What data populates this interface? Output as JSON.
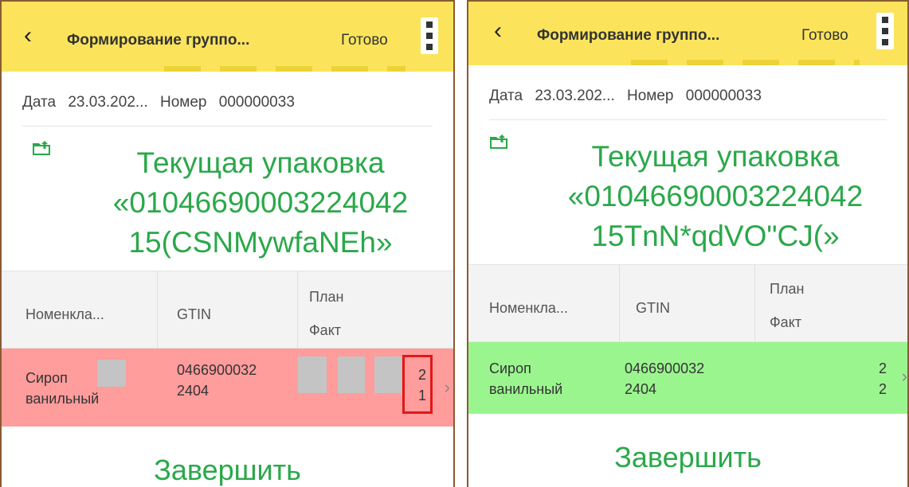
{
  "screens": [
    {
      "header": {
        "back_icon": "chevron-left-icon",
        "title": "Формирование группо...",
        "done_label": "Готово",
        "menu_icon": "more-vertical-icon"
      },
      "info": {
        "date_label": "Дата",
        "date_value": "23.03.202...",
        "number_label": "Номер",
        "number_value": "000000033"
      },
      "current_package": {
        "icon": "package-upload-icon",
        "line1": "Текущая упаковка",
        "line2": "«01046690003224042",
        "line3": "15(CSNMywfaNEh»"
      },
      "table": {
        "col_nomenclature": "Номенкла...",
        "col_gtin": "GTIN",
        "col_plan": "План",
        "col_fact": "Факт",
        "row": {
          "name_line1": "Сироп",
          "name_line2": "ванильный",
          "gtin_line1": "0466900032",
          "gtin_line2": "2404",
          "plan": "2",
          "fact": "1",
          "status_color": "#ff9c9c"
        }
      },
      "finish_label": "Завершить"
    },
    {
      "header": {
        "back_icon": "chevron-left-icon",
        "title": "Формирование группо...",
        "done_label": "Готово",
        "menu_icon": "more-vertical-icon"
      },
      "info": {
        "date_label": "Дата",
        "date_value": "23.03.202...",
        "number_label": "Номер",
        "number_value": "000000033"
      },
      "current_package": {
        "icon": "package-upload-icon",
        "line1": "Текущая упаковка",
        "line2": "«01046690003224042",
        "line3": "15TnN*qdVO\"CJ(»"
      },
      "table": {
        "col_nomenclature": "Номенкла...",
        "col_gtin": "GTIN",
        "col_plan": "План",
        "col_fact": "Факт",
        "row": {
          "name_line1": "Сироп",
          "name_line2": "ванильный",
          "gtin_line1": "0466900032",
          "gtin_line2": "2404",
          "plan": "2",
          "fact": "2",
          "status_color": "#9bf58f"
        }
      },
      "finish_label": "Завершить"
    }
  ],
  "colors": {
    "header_bg": "#fbe45c",
    "accent_green": "#2aa84a",
    "highlight_red": "#e11818"
  }
}
